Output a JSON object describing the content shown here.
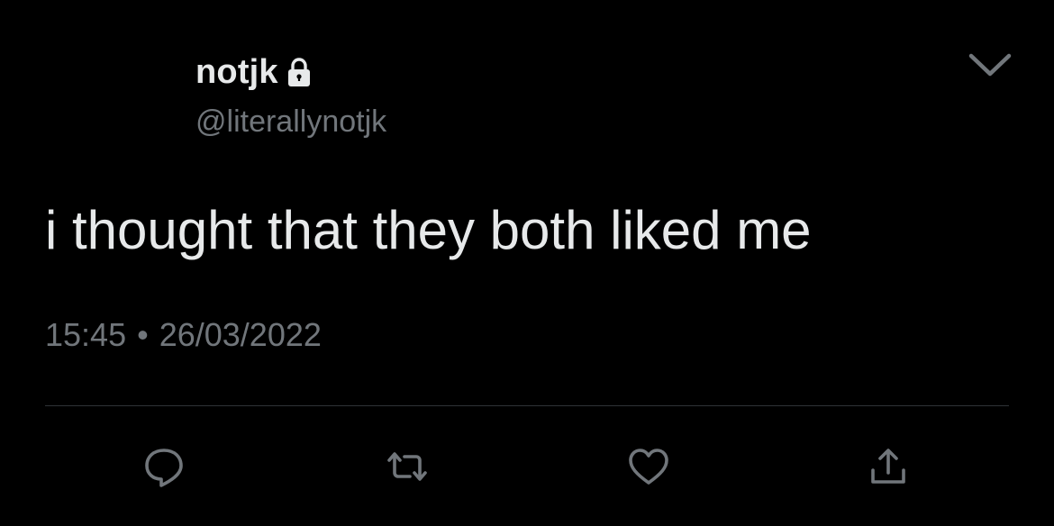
{
  "tweet": {
    "display_name": "notjk",
    "handle": "@literallynotjk",
    "protected_icon": "lock-icon",
    "text": "i thought that they both liked me",
    "time": "15:45",
    "separator": "•",
    "date": "26/03/2022"
  },
  "actions": [
    {
      "name": "reply",
      "icon": "comment-icon"
    },
    {
      "name": "retweet",
      "icon": "retweet-icon"
    },
    {
      "name": "like",
      "icon": "heart-icon"
    },
    {
      "name": "share",
      "icon": "share-icon"
    }
  ],
  "colors": {
    "background": "#000000",
    "primary_text": "#e7e9ea",
    "secondary_text": "#71767b",
    "divider": "#2f3336"
  }
}
